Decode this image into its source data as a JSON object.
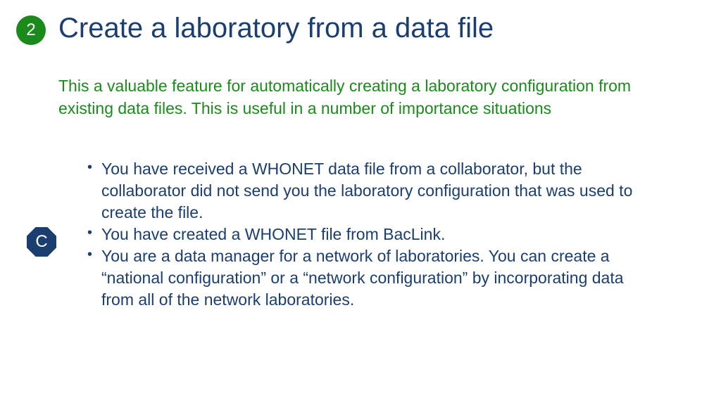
{
  "step": {
    "number": "2",
    "title": "Create a laboratory from a data file"
  },
  "intro": "This a valuable feature for automatically creating a  laboratory configuration from existing data files.  This is useful in a number of importance situations",
  "section_letter": "C",
  "bullets": [
    "You have received a WHONET data file from a collaborator, but the collaborator did not send you the laboratory configuration that was used to create the file.",
    "You have created a WHONET file from BacLink.",
    "You are a data manager for a network of laboratories.  You can create a “national configuration” or a “network configuration” by incorporating data from all of the network laboratories."
  ]
}
